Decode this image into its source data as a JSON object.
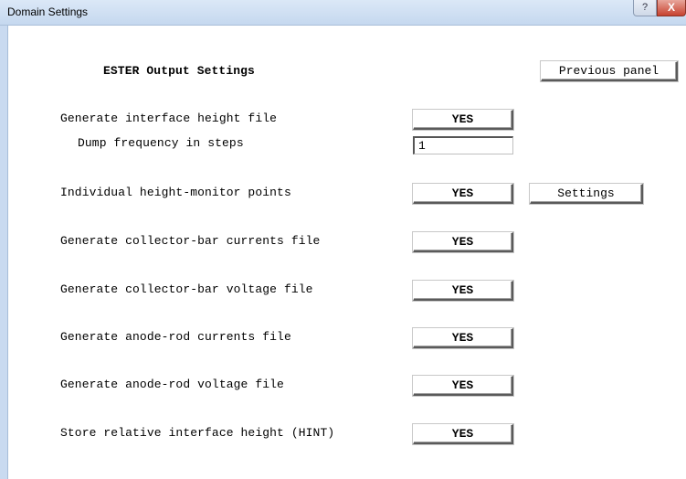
{
  "window": {
    "title": "Domain Settings",
    "help_glyph": "?",
    "close_glyph": "X"
  },
  "panel": {
    "heading": "ESTER Output Settings",
    "previous_label": "Previous panel"
  },
  "rows": {
    "interface_height": {
      "label": "Generate interface height file",
      "button": "YES"
    },
    "dump_frequency": {
      "label": "Dump frequency in steps",
      "value": "1"
    },
    "monitor_points": {
      "label": "Individual height-monitor points",
      "button": "YES",
      "settings": "Settings"
    },
    "collector_currents": {
      "label": "Generate collector-bar currents file",
      "button": "YES"
    },
    "collector_voltage": {
      "label": "Generate collector-bar voltage file",
      "button": "YES"
    },
    "anode_currents": {
      "label": "Generate anode-rod currents file",
      "button": "YES"
    },
    "anode_voltage": {
      "label": "Generate anode-rod voltage file",
      "button": "YES"
    },
    "hint": {
      "label": "Store relative interface height (HINT)",
      "button": "YES"
    }
  }
}
